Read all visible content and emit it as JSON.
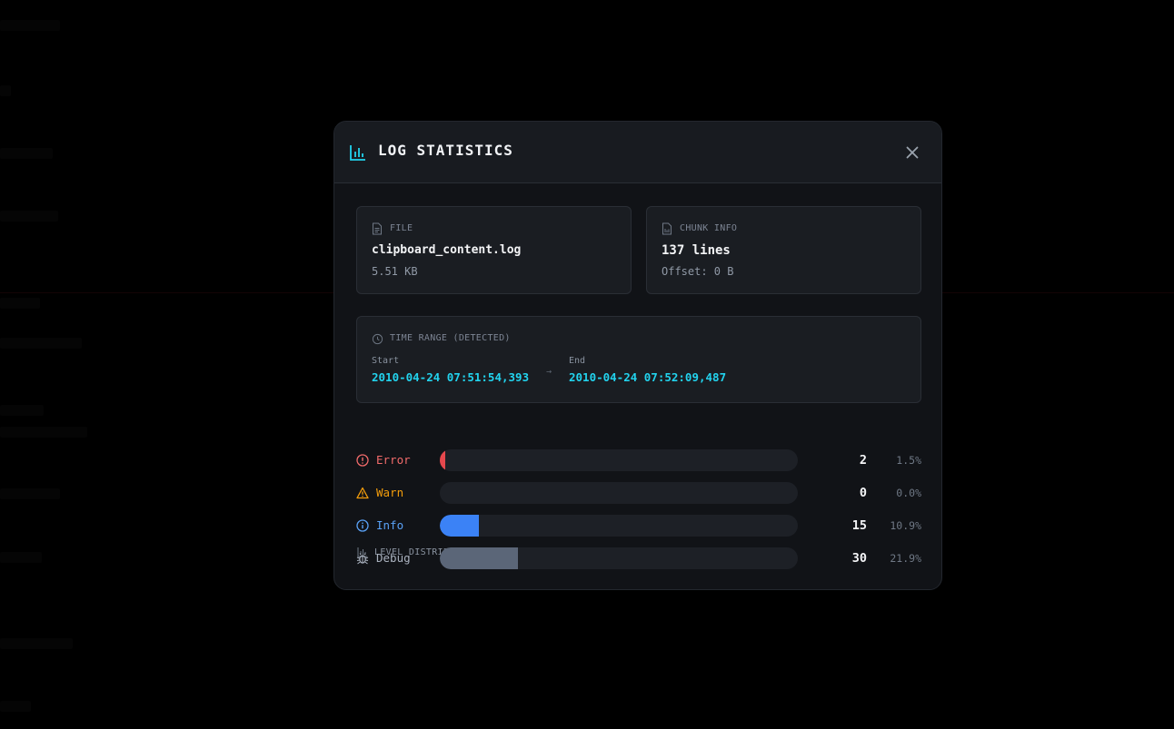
{
  "modal": {
    "title": "LOG STATISTICS"
  },
  "file_card": {
    "label": "FILE",
    "name": "clipboard_content.log",
    "size": "5.51 KB"
  },
  "chunk_card": {
    "label": "CHUNK INFO",
    "lines": "137 lines",
    "offset": "Offset: 0 B"
  },
  "time_range": {
    "label": "TIME RANGE (DETECTED)",
    "start_label": "Start",
    "start_value": "2010-04-24 07:51:54,393",
    "arrow": "→",
    "end_label": "End",
    "end_value": "2010-04-24 07:52:09,487"
  },
  "distribution": {
    "label": "LEVEL DISTRIBUTION (CURRENT CHUNK)",
    "levels": [
      {
        "name": "Error",
        "count": "2",
        "percent": "1.5%",
        "fraction": 0.015,
        "color": "#e5484d",
        "icon": "error-icon"
      },
      {
        "name": "Warn",
        "count": "0",
        "percent": "0.0%",
        "fraction": 0.0,
        "color": "#f59e0b",
        "icon": "warning-icon"
      },
      {
        "name": "Info",
        "count": "15",
        "percent": "10.9%",
        "fraction": 0.109,
        "color": "#3b82f6",
        "icon": "info-icon"
      },
      {
        "name": "Debug",
        "count": "30",
        "percent": "21.9%",
        "fraction": 0.219,
        "color": "#5b6678",
        "icon": "bug-icon"
      }
    ]
  },
  "colors": {
    "accent": "#22d3ee",
    "error_label": "#f26b6b",
    "warn_label": "#f59e0b",
    "info_label": "#5aa2f7",
    "debug_label": "#aab2bf"
  }
}
